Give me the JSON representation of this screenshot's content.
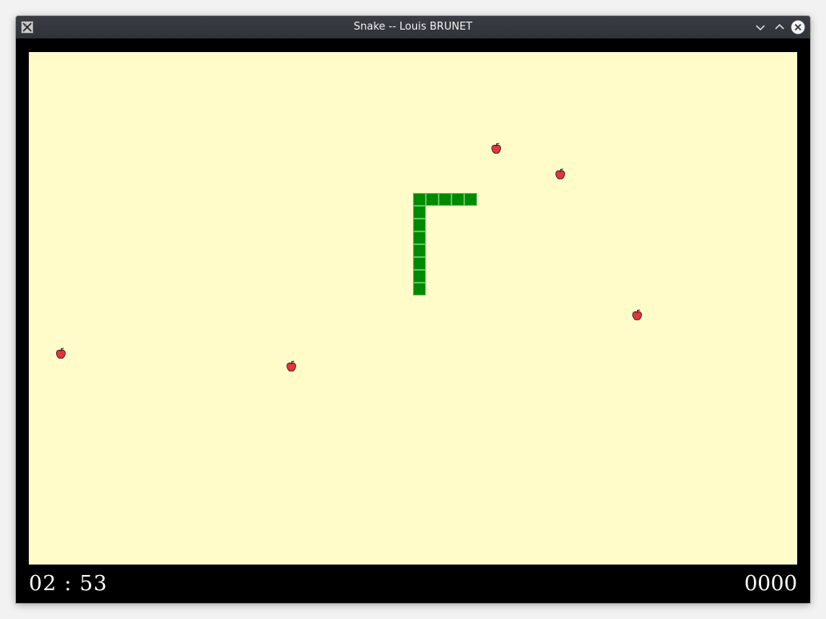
{
  "window": {
    "title": "Snake -- Louis BRUNET"
  },
  "titlebar_icons": [
    "app-icon",
    "minimize-chevron-down-icon",
    "maximize-chevron-up-icon",
    "close-x-icon"
  ],
  "game": {
    "board_color": "#fffcc9",
    "snake_color": "#008a00",
    "apple_color": "#e8323c",
    "grid_cols": 60,
    "grid_rows": 40,
    "snake_cells": [
      [
        32,
        11
      ],
      [
        33,
        11
      ],
      [
        34,
        11
      ],
      [
        30,
        11
      ],
      [
        30,
        12
      ],
      [
        30,
        13
      ],
      [
        30,
        14
      ],
      [
        30,
        15
      ],
      [
        30,
        16
      ],
      [
        30,
        17
      ],
      [
        30,
        18
      ],
      [
        31,
        11
      ]
    ],
    "apple_cells": [
      [
        36,
        7
      ],
      [
        41,
        9
      ],
      [
        47,
        20
      ],
      [
        2,
        23
      ],
      [
        20,
        24
      ]
    ]
  },
  "footer": {
    "timer_minutes": "02",
    "timer_separator": ":",
    "timer_seconds": "53",
    "score": "0000"
  }
}
